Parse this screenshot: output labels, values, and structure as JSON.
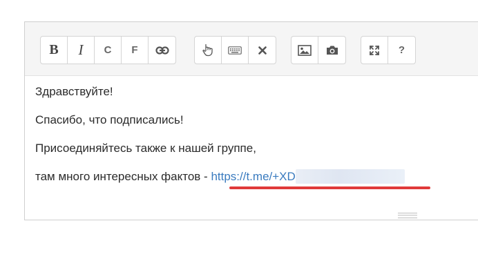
{
  "toolbar": {
    "groups": [
      {
        "buttons": [
          {
            "label": "B",
            "icon": "bold-icon"
          },
          {
            "label": "I",
            "icon": "italic-icon"
          },
          {
            "label": "C",
            "icon": "c-format-icon"
          },
          {
            "label": "F",
            "icon": "f-format-icon"
          },
          {
            "icon": "link-icon"
          }
        ]
      },
      {
        "buttons": [
          {
            "icon": "hand-pointer-icon"
          },
          {
            "icon": "keyboard-icon"
          },
          {
            "icon": "close-icon"
          }
        ]
      },
      {
        "buttons": [
          {
            "icon": "image-icon"
          },
          {
            "icon": "camera-icon"
          }
        ]
      },
      {
        "buttons": [
          {
            "icon": "fullscreen-icon"
          },
          {
            "label": "?",
            "icon": "help-icon"
          }
        ]
      }
    ]
  },
  "content": {
    "line1": "Здравствуйте!",
    "line2": "Спасибо, что подписались!",
    "line3": "Присоединяйтесь также к нашей группе,",
    "line4_prefix": "там много интересных фактов - ",
    "link_text": "https://t.me/+XD"
  },
  "colors": {
    "link": "#3a7bbf",
    "annotation_underline": "#e03a3a",
    "toolbar_bg": "#f5f5f5"
  }
}
